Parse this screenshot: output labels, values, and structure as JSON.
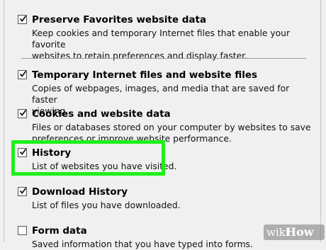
{
  "options": [
    {
      "id": "preserve-favorites",
      "checked": true,
      "title": "Preserve Favorites website data",
      "desc_lines": [
        "Keep cookies and temporary Internet files that enable your favorite",
        "websites to retain preferences and display faster."
      ]
    },
    {
      "id": "temp-files",
      "checked": true,
      "title": "Temporary Internet files and website files",
      "desc_lines": [
        "Copies of webpages, images, and media that are saved for faster",
        "viewing."
      ]
    },
    {
      "id": "cookies",
      "checked": true,
      "title": "Cookies and website data",
      "desc_lines": [
        "Files or databases stored on your computer by websites to save",
        "preferences or improve website performance."
      ]
    },
    {
      "id": "history",
      "checked": true,
      "title": "History",
      "desc_lines": [
        "List of websites you have visited."
      ]
    },
    {
      "id": "download-history",
      "checked": true,
      "title": "Download History",
      "desc_lines": [
        "List of files you have downloaded."
      ]
    },
    {
      "id": "form-data",
      "checked": false,
      "title": "Form data",
      "desc_lines": [
        "Saved information that you have typed into forms."
      ]
    }
  ],
  "highlight_color": "#1ef01a",
  "watermark": {
    "wiki": "wiki",
    "how": "How"
  }
}
